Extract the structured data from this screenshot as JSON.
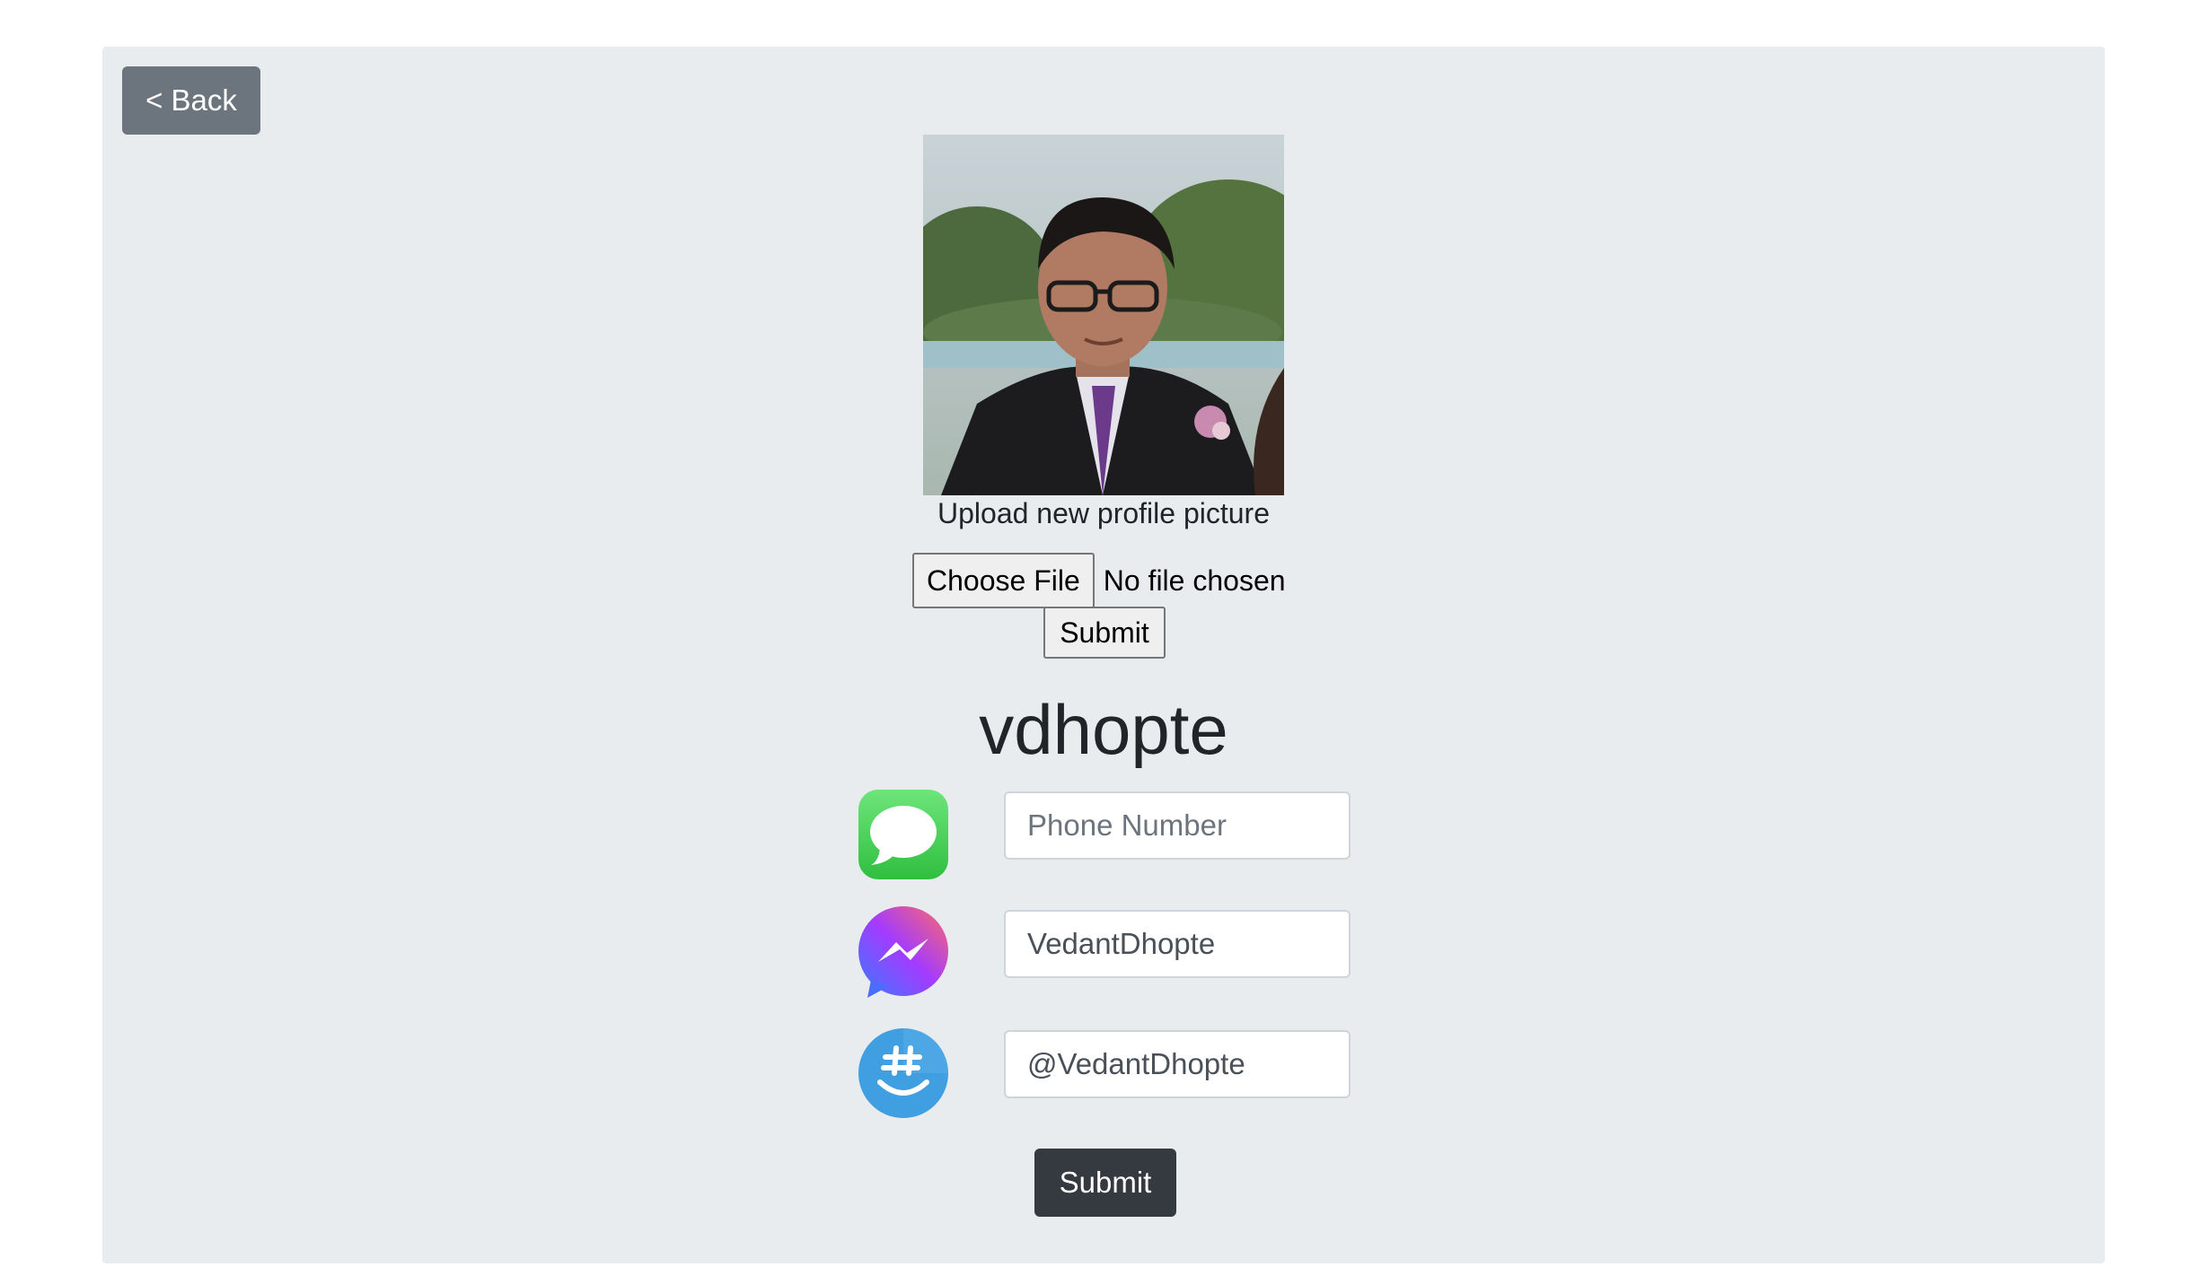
{
  "nav": {
    "back_label": "< Back"
  },
  "profile": {
    "upload_label": "Upload new profile picture",
    "choose_file_label": "Choose File",
    "file_status": "No file chosen",
    "upload_submit_label": "Submit",
    "username": "vdhopte"
  },
  "contacts": [
    {
      "icon": "imessage-icon",
      "placeholder": "Phone Number",
      "value": ""
    },
    {
      "icon": "messenger-icon",
      "placeholder": "",
      "value": "VedantDhopte"
    },
    {
      "icon": "groupme-icon",
      "placeholder": "",
      "value": "@VedantDhopte"
    }
  ],
  "form": {
    "submit_label": "Submit"
  },
  "colors": {
    "card_bg": "#e9ecef",
    "back_button": "#6c757d",
    "submit_button": "#343a40",
    "imessage_green": "#4cd964",
    "groupme_blue": "#3f9fe0"
  }
}
